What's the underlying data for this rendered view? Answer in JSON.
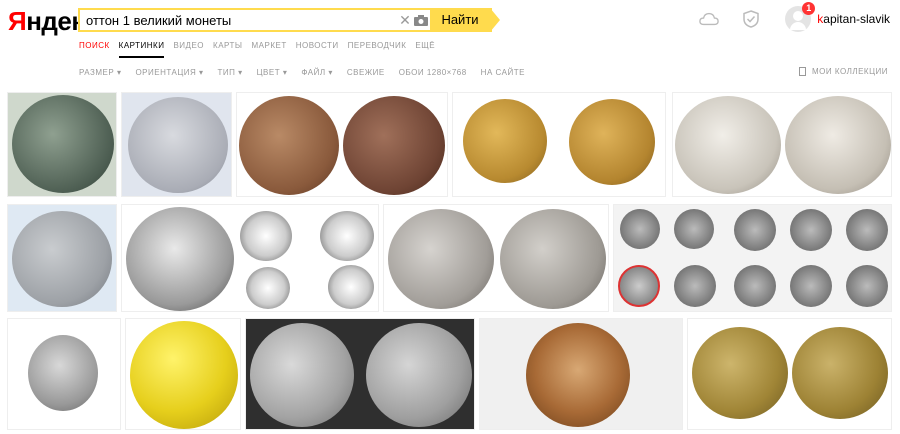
{
  "logo": {
    "first": "Я",
    "rest": "ндекс"
  },
  "search": {
    "query": "оттон 1 великий монеты",
    "button": "Найти"
  },
  "user": {
    "first": "k",
    "rest": "apitan-slavik",
    "notifications": "1"
  },
  "nav": {
    "items": [
      "ПОИСК",
      "КАРТИНКИ",
      "ВИДЕО",
      "КАРТЫ",
      "МАРКЕТ",
      "НОВОСТИ",
      "ПЕРЕВОДЧИК",
      "ЕЩЁ"
    ]
  },
  "filters": {
    "items": [
      "РАЗМЕР ▾",
      "ОРИЕНТАЦИЯ ▾",
      "ТИП ▾",
      "ЦВЕТ ▾",
      "ФАЙЛ ▾",
      "СВЕЖИЕ",
      "ОБОИ 1280×768",
      "НА САЙТЕ"
    ]
  },
  "collections": "МОИ КОЛЛЕКЦИИ",
  "icons": [
    "yandex-logo",
    "clear-icon",
    "camera-icon",
    "weather-icon",
    "shield-icon",
    "avatar",
    "bookmark-icon"
  ],
  "colors": {
    "accent": "#ffdb4d",
    "brand_red": "#ff0000"
  }
}
